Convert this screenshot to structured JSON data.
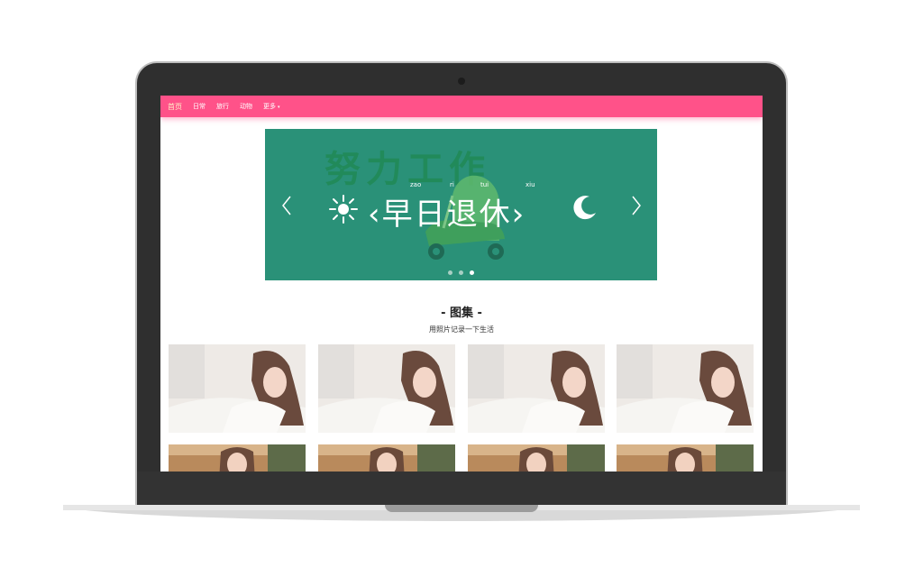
{
  "nav": {
    "items": [
      {
        "label": "首页",
        "active": true
      },
      {
        "label": "日常",
        "active": false
      },
      {
        "label": "旅行",
        "active": false
      },
      {
        "label": "动物",
        "active": false
      },
      {
        "label": "更多",
        "active": false
      }
    ],
    "caret": "▾"
  },
  "banner": {
    "bg_text": "努力工作",
    "main_text": "‹早日退休›",
    "pinyin": [
      "zao",
      "ri",
      "tui",
      "xiu"
    ],
    "slides": 3,
    "active_slide": 3,
    "colors": {
      "bg": "#2a9178",
      "accent": "#218a5a"
    }
  },
  "gallery": {
    "title": "- 图集 -",
    "subtitle": "用照片记录一下生活",
    "rows": [
      {
        "items": [
          "photo",
          "photo",
          "photo",
          "photo"
        ]
      },
      {
        "items": [
          "photo",
          "photo",
          "photo",
          "photo"
        ]
      }
    ]
  },
  "theme": {
    "nav_color": "#ff5289"
  }
}
